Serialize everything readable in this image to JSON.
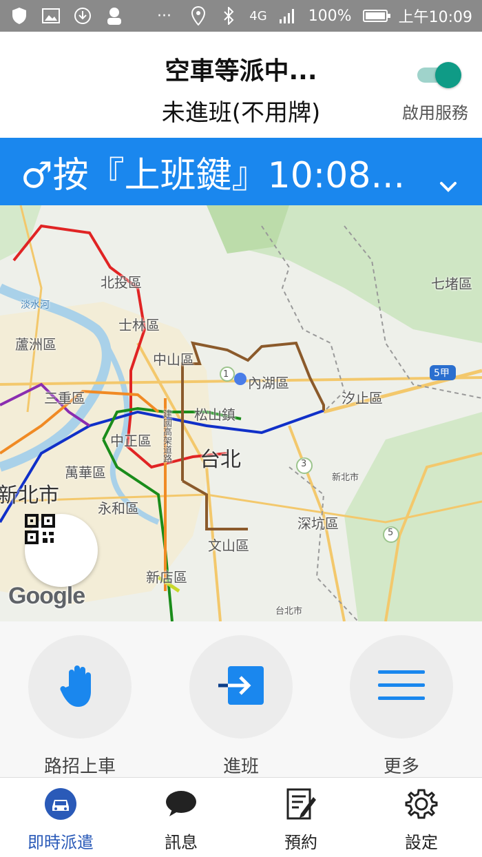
{
  "status_bar": {
    "network": "4G",
    "battery": "100%",
    "time": "上午10:09",
    "dots": "···"
  },
  "header": {
    "title": "空車等派中...",
    "subtitle": "未進班(不用牌)",
    "service_toggle_label": "啟用服務",
    "service_enabled": true
  },
  "banner": {
    "text": "♂按『上班鍵』10:08..."
  },
  "map": {
    "labels": {
      "beitou": "北投區",
      "qidu": "七堵區",
      "shilin": "士林區",
      "luzhou": "蘆洲區",
      "zhongshan": "中山區",
      "neihu": "內湖區",
      "sanchong": "三重區",
      "xizhi": "汐止區",
      "songshan": "松山鎮",
      "zhongzheng": "中正區",
      "taipei": "台北",
      "wanhua": "萬華區",
      "new_taipei": "新北市",
      "yonghe": "永和區",
      "shenkeng": "深坑區",
      "wenshan": "文山區",
      "xindian": "新店區",
      "tamsui_river": "淡水河",
      "jianguo_road": "建國高架道路",
      "route_5jia": "5甲",
      "route_3": "3",
      "route_5": "5",
      "route_1": "1",
      "xinbei_city_small": "新北市",
      "taibei_city_small": "台北市"
    },
    "attribution": "Google"
  },
  "actions": [
    {
      "label": "路招上車",
      "icon": "hand-icon"
    },
    {
      "label": "進班",
      "icon": "login-arrow-icon"
    },
    {
      "label": "更多",
      "icon": "menu-lines-icon"
    }
  ],
  "tabs": [
    {
      "label": "即時派遣",
      "icon": "taxi-icon",
      "active": true
    },
    {
      "label": "訊息",
      "icon": "chat-bubble-icon",
      "active": false
    },
    {
      "label": "預約",
      "icon": "note-edit-icon",
      "active": false
    },
    {
      "label": "設定",
      "icon": "gear-icon",
      "active": false
    }
  ],
  "colors": {
    "banner": "#1a87ee",
    "toggle_on": "#0f9b86",
    "active_tab": "#2a5ab8",
    "status_bar": "#8a8a8a"
  }
}
